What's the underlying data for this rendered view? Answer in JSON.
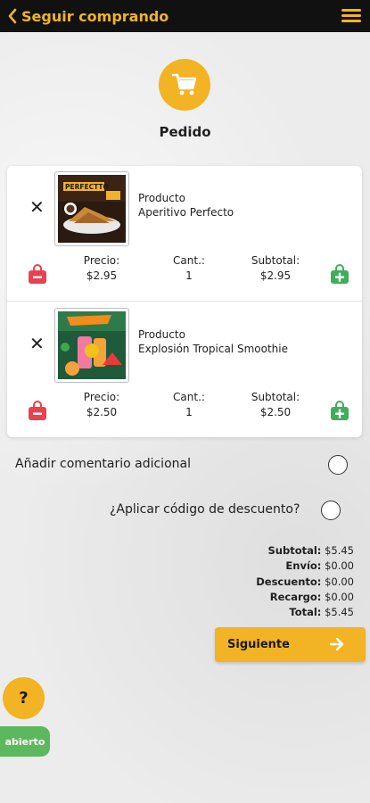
{
  "header": {
    "back_label": "Seguir comprando",
    "bg_color": "#111111",
    "accent_color": "#f2b324"
  },
  "page": {
    "title": "Pedido"
  },
  "cart": {
    "items": [
      {
        "label": "Producto",
        "name": "Aperitivo Perfecto",
        "image_caption": "PERFECTTO",
        "price_label": "Precio:",
        "price": "$2.95",
        "qty_label": "Cant.:",
        "qty": "1",
        "subtotal_label": "Subtotal:",
        "subtotal": "$2.95"
      },
      {
        "label": "Producto",
        "name": "Explosión Tropical Smoothie",
        "price_label": "Precio:",
        "price": "$2.50",
        "qty_label": "Cant.:",
        "qty": "1",
        "subtotal_label": "Subtotal:",
        "subtotal": "$2.50"
      }
    ]
  },
  "options": {
    "comment_label": "Añadir comentario adicional",
    "discount_label": "¿Aplicar código de descuento?"
  },
  "totals": {
    "subtotal_label": "Subtotal:",
    "subtotal": "$5.45",
    "shipping_label": "Envío:",
    "shipping": "$0.00",
    "discount_label": "Descuento:",
    "discount": "$0.00",
    "surcharge_label": "Recargo:",
    "surcharge": "$0.00",
    "total_label": "Total:",
    "total": "$5.45"
  },
  "actions": {
    "next_label": "Siguiente"
  },
  "help": {
    "label": "?"
  },
  "status": {
    "label": "abierto",
    "color": "#5cb85c"
  },
  "icons": {
    "back": "chevron-left-icon",
    "menu": "hamburger-menu-icon",
    "cart": "shopping-cart-icon",
    "remove": "close-icon",
    "minus": "bag-minus-icon",
    "plus": "bag-plus-icon",
    "arrow": "arrow-right-icon"
  }
}
